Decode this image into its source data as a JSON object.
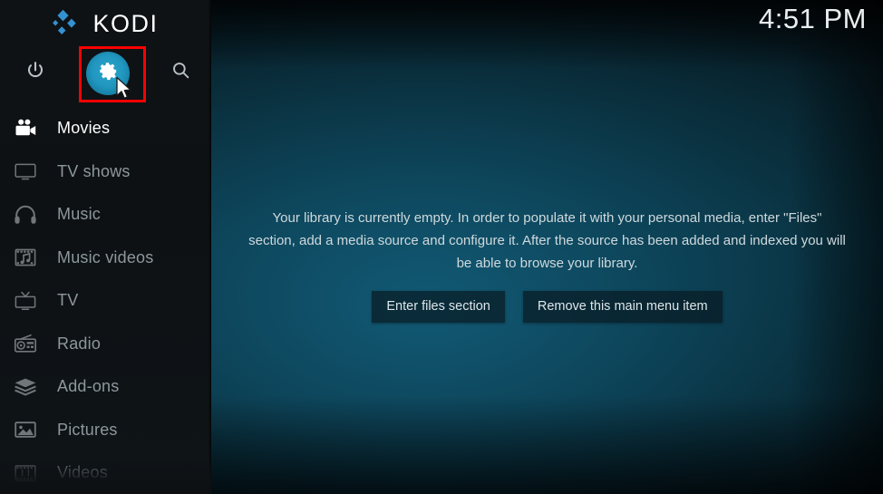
{
  "app": {
    "logo_text": "KODI",
    "logo_icon": "kodi-logo-icon"
  },
  "clock": {
    "time": "4:51 PM"
  },
  "topbar": {
    "power_icon": "power-icon",
    "settings_icon": "gear-icon",
    "search_icon": "search-icon",
    "highlight_color": "#ff0000",
    "settings_accent": "#2197bf"
  },
  "sidebar": {
    "items": [
      {
        "label": "Movies",
        "icon": "movie-camera-icon",
        "state": "selected"
      },
      {
        "label": "TV shows",
        "icon": "tv-monitor-icon",
        "state": "normal"
      },
      {
        "label": "Music",
        "icon": "headphones-icon",
        "state": "normal"
      },
      {
        "label": "Music videos",
        "icon": "film-note-icon",
        "state": "normal"
      },
      {
        "label": "TV",
        "icon": "tv-antenna-icon",
        "state": "normal"
      },
      {
        "label": "Radio",
        "icon": "radio-icon",
        "state": "normal"
      },
      {
        "label": "Add-ons",
        "icon": "addon-box-icon",
        "state": "normal"
      },
      {
        "label": "Pictures",
        "icon": "picture-frame-icon",
        "state": "normal"
      },
      {
        "label": "Videos",
        "icon": "film-strip-icon",
        "state": "dim"
      }
    ]
  },
  "main": {
    "empty_message": "Your library is currently empty. In order to populate it with your personal media, enter \"Files\" section, add a media source and configure it. After the source has been added and indexed you will be able to browse your library.",
    "buttons": {
      "enter_files": "Enter files section",
      "remove_item": "Remove this main menu item"
    }
  }
}
